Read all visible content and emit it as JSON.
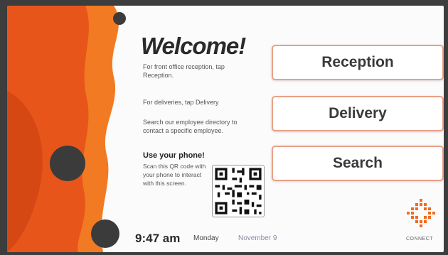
{
  "welcome": {
    "title": "Welcome!",
    "reception_text": "For front office reception, tap Reception.",
    "delivery_text": "For deliveries, tap Delivery",
    "search_text": "Search our employee directory to contact a specific employee."
  },
  "phone": {
    "heading": "Use your phone!",
    "text": "Scan this QR code with your phone to interact with this screen."
  },
  "buttons": {
    "reception": "Reception",
    "delivery": "Delivery",
    "search": "Search"
  },
  "status": {
    "time": "9:47 am",
    "day": "Monday",
    "date": "November 9"
  },
  "brand": {
    "name": "CONNECT",
    "accent": "#f26b1d",
    "button_border": "#e8a088"
  },
  "icons": {
    "qr": "qr-code-icon",
    "logo": "connect-logo-icon"
  }
}
